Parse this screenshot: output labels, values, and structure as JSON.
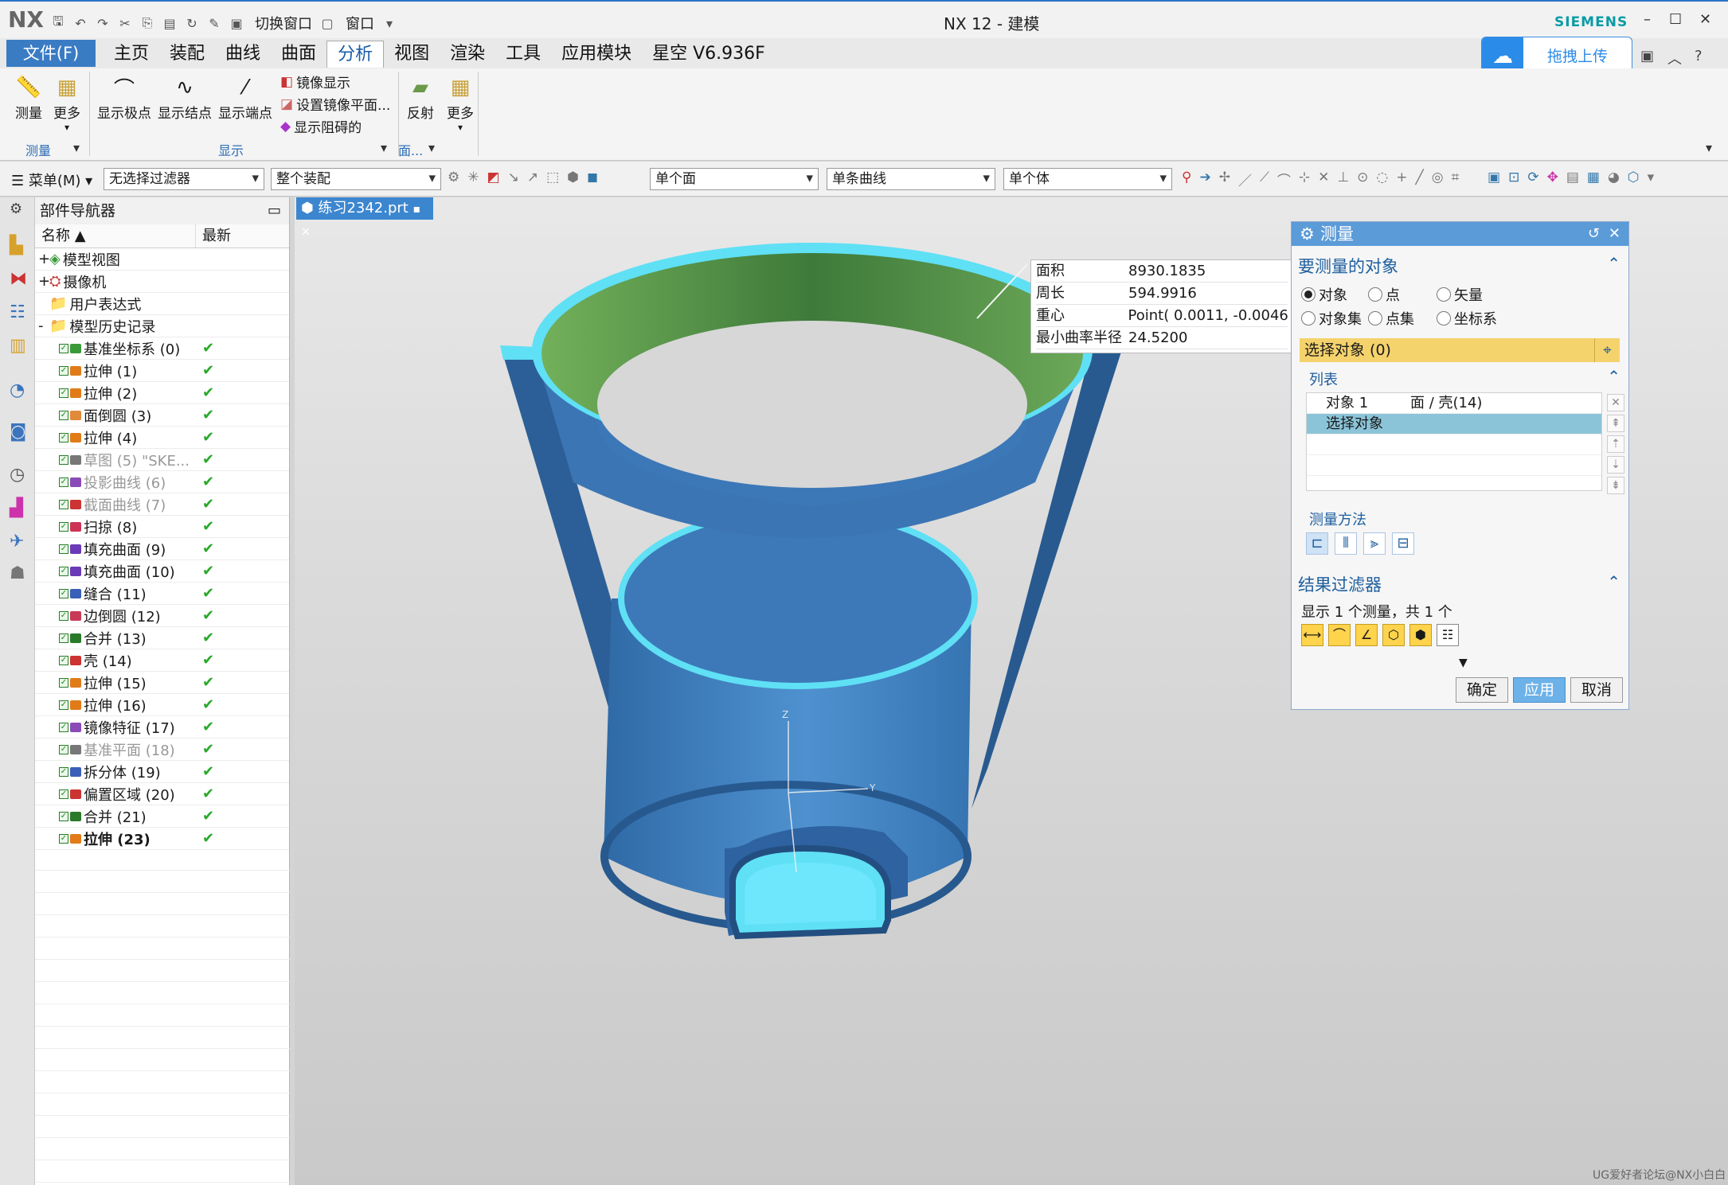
{
  "app": {
    "logo": "NX",
    "title": "NX 12 - 建模",
    "vendor": "SIEMENS",
    "quick_switch": "切换窗口",
    "quick_window": "窗口"
  },
  "menu": {
    "file": "文件(F)",
    "tabs": [
      "主页",
      "装配",
      "曲线",
      "曲面",
      "分析",
      "视图",
      "渲染",
      "工具",
      "应用模块",
      "星空 V6.936F"
    ],
    "active_tab": "分析"
  },
  "upload": {
    "label": "拖拽上传"
  },
  "ribbon": {
    "measure": "测量",
    "more1": "更多",
    "group_measure": "测量",
    "show_pole": "显示极点",
    "show_knot": "显示结点",
    "show_end": "显示端点",
    "mirror_show": "镜像显示",
    "set_mirror": "设置镜像平面...",
    "show_block": "显示阻碍的",
    "group_show": "显示",
    "reflect": "反射",
    "more2": "更多",
    "group_face": "面..."
  },
  "selection": {
    "menu": "菜单(M)",
    "filter": "无选择过滤器",
    "scope": "整个装配",
    "face_rule": "单个面",
    "curve_rule": "单条曲线",
    "body_rule": "单个体"
  },
  "navigator": {
    "title": "部件导航器",
    "col_name": "名称",
    "col_latest": "最新",
    "top_items": [
      {
        "label": "模型视图",
        "expand": "+"
      },
      {
        "label": "摄像机",
        "expand": "+"
      },
      {
        "label": "用户表达式",
        "expand": ""
      },
      {
        "label": "模型历史记录",
        "expand": "-"
      }
    ],
    "features": [
      {
        "label": "基准坐标系 (0)",
        "state": "normal",
        "latest": "✔"
      },
      {
        "label": "拉伸 (1)",
        "state": "normal",
        "latest": "✔"
      },
      {
        "label": "拉伸 (2)",
        "state": "normal",
        "latest": "✔"
      },
      {
        "label": "面倒圆 (3)",
        "state": "normal",
        "latest": "✔"
      },
      {
        "label": "拉伸 (4)",
        "state": "normal",
        "latest": "✔"
      },
      {
        "label": "草图 (5) \"SKE...",
        "state": "dim",
        "latest": "✔"
      },
      {
        "label": "投影曲线 (6)",
        "state": "dim",
        "latest": "✔"
      },
      {
        "label": "截面曲线 (7)",
        "state": "dim",
        "latest": "✔"
      },
      {
        "label": "扫掠 (8)",
        "state": "normal",
        "latest": "✔"
      },
      {
        "label": "填充曲面 (9)",
        "state": "normal",
        "latest": "✔"
      },
      {
        "label": "填充曲面 (10)",
        "state": "normal",
        "latest": "✔"
      },
      {
        "label": "缝合 (11)",
        "state": "normal",
        "latest": "✔"
      },
      {
        "label": "边倒圆 (12)",
        "state": "normal",
        "latest": "✔"
      },
      {
        "label": "合并 (13)",
        "state": "normal",
        "latest": "✔"
      },
      {
        "label": "壳 (14)",
        "state": "normal",
        "latest": "✔"
      },
      {
        "label": "拉伸 (15)",
        "state": "normal",
        "latest": "✔"
      },
      {
        "label": "拉伸 (16)",
        "state": "normal",
        "latest": "✔"
      },
      {
        "label": "镜像特征 (17)",
        "state": "normal",
        "latest": "✔"
      },
      {
        "label": "基准平面 (18)",
        "state": "dim",
        "latest": "✔"
      },
      {
        "label": "拆分体 (19)",
        "state": "normal",
        "latest": "✔"
      },
      {
        "label": "偏置区域 (20)",
        "state": "normal",
        "latest": "✔"
      },
      {
        "label": "合并 (21)",
        "state": "normal",
        "latest": "✔"
      },
      {
        "label": "拉伸 (23)",
        "state": "bold",
        "latest": "✔"
      }
    ]
  },
  "document": {
    "tab": "练习2342.prt"
  },
  "measure_info": [
    {
      "key": "面积",
      "value": "8930.1835"
    },
    {
      "key": "周长",
      "value": "594.9916"
    },
    {
      "key": "重心",
      "value": "Point( 0.0011, -0.0046"
    },
    {
      "key": "最小曲率半径",
      "value": "24.5200"
    }
  ],
  "dialog": {
    "title": "测量",
    "section_objects": "要测量的对象",
    "radios": [
      "对象",
      "点",
      "矢量",
      "对象集",
      "点集",
      "坐标系"
    ],
    "selected_radio": "对象",
    "select_object": "选择对象 (0)",
    "list_title": "列表",
    "list_rows": [
      {
        "a": "对象 1",
        "b": "面 / 壳(14)"
      },
      {
        "a": "选择对象",
        "b": ""
      }
    ],
    "method_title": "测量方法",
    "filter_title": "结果过滤器",
    "filter_text": "显示 1 个测量，共 1 个",
    "ok": "确定",
    "apply": "应用",
    "cancel": "取消"
  },
  "watermark": "UG爱好者论坛@NX小白白",
  "colors": {
    "accent": "#3a7cc4",
    "model_blue": "#3d79b8",
    "model_cyan": "#5fe0f5",
    "face_green": "#5c9a50",
    "selection_yellow": "#f5d36c"
  }
}
